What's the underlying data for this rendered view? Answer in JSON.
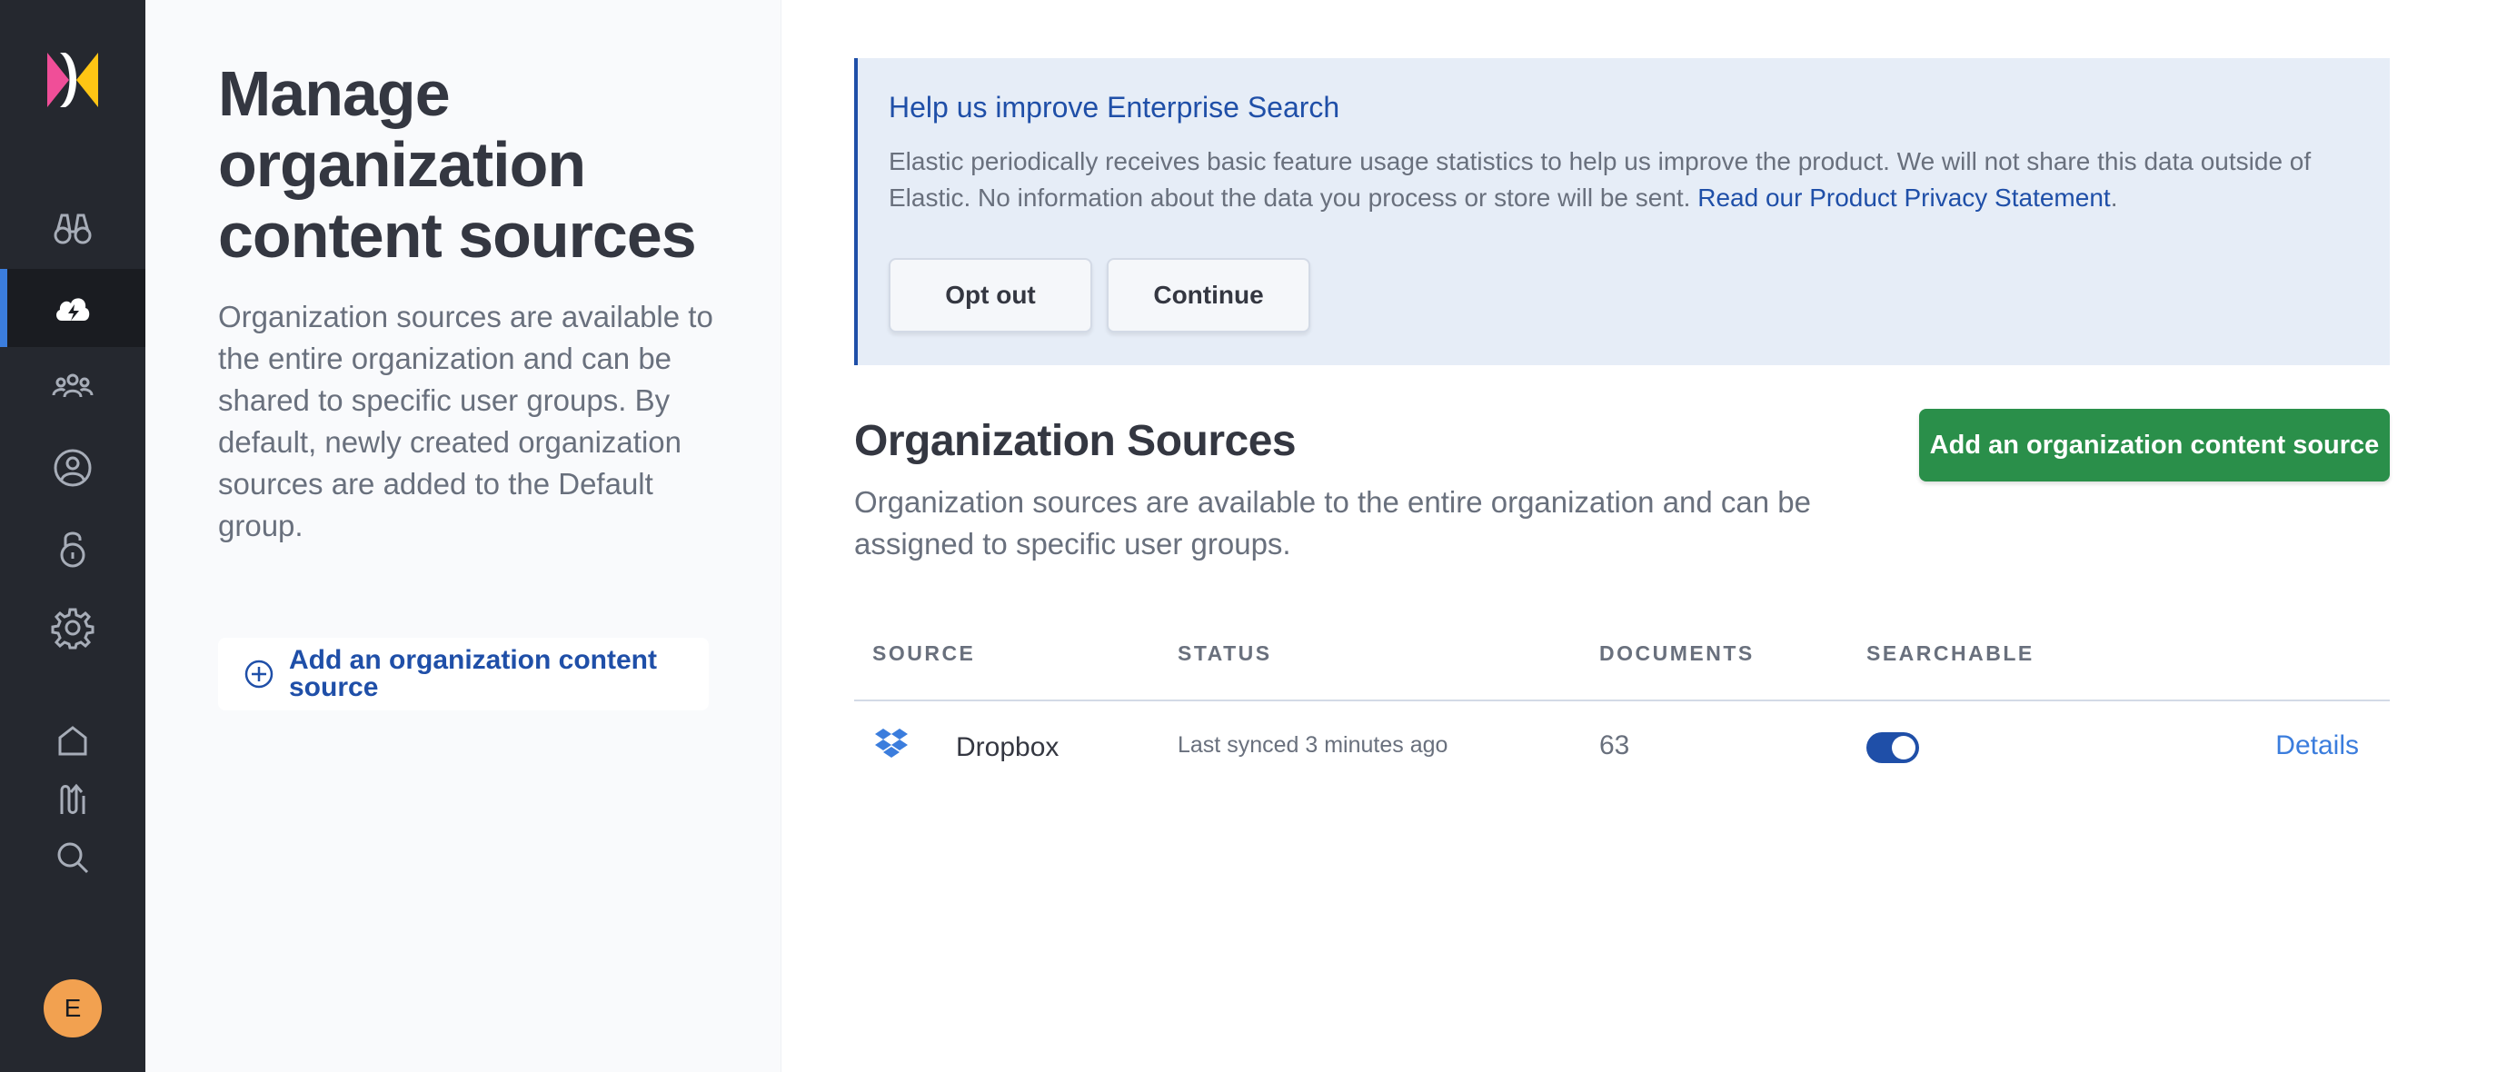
{
  "side": {
    "title": "Manage organization content sources",
    "description": "Organization sources are available to the entire organization and can be shared to specific user groups. By default, newly created organization sources are added to the Default group.",
    "add_label": "Add an organization content source"
  },
  "callout": {
    "title": "Help us improve Enterprise Search",
    "body": "Elastic periodically receives basic feature usage statistics to help us improve the product. We will not share this data outside of Elastic. No information about the data you process or store will be sent. ",
    "link": "Read our Product Privacy Statement",
    "body_end": ".",
    "opt_out": "Opt out",
    "continue": "Continue"
  },
  "section": {
    "title": "Organization Sources",
    "description": "Organization sources are available to the entire organization and can be assigned to specific user groups.",
    "add_button": "Add an organization content source"
  },
  "table": {
    "headers": {
      "source": "SOURCE",
      "status": "STATUS",
      "documents": "DOCUMENTS",
      "searchable": "SEARCHABLE"
    },
    "rows": [
      {
        "name": "Dropbox",
        "icon": "dropbox-icon",
        "status": "Last synced 3 minutes ago",
        "documents": "63",
        "searchable": true,
        "action": "Details"
      }
    ]
  },
  "user": {
    "initial": "E"
  },
  "colors": {
    "accent": "#1f4fa8",
    "success": "#2a8f4a",
    "rail": "#25282f",
    "avatar": "#f2a150"
  }
}
